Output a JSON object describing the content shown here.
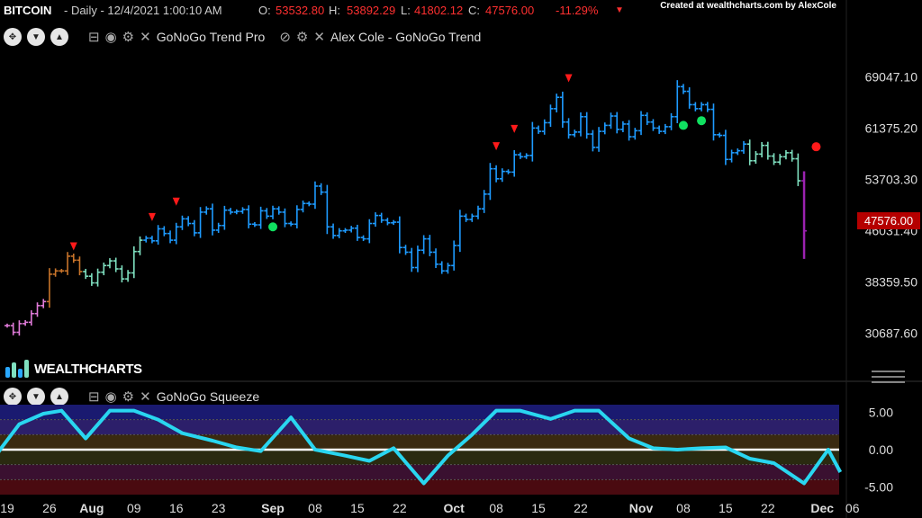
{
  "header": {
    "symbol": "BITCOIN",
    "info": "- Daily - 12/4/2021 1:00:10 AM",
    "o_label": "O:",
    "o_val": "53532.80",
    "h_label": "H:",
    "h_val": "53892.29",
    "l_label": "L:",
    "l_val": "41802.12",
    "c_label": "C:",
    "c_val": "47576.00",
    "change": "-11.29%",
    "dropdown": "▼"
  },
  "credit": "Created at wealthcharts.com by AlexCole",
  "indicators": {
    "main": [
      "GoNoGo Trend Pro",
      "Alex Cole - GoNoGo Trend"
    ],
    "lower": "GoNoGo Squeeze"
  },
  "logo_text": "WEALTHCHARTS",
  "price_badge": "47576.00",
  "colors": {
    "strong_go": "#1e9bff",
    "weak_go": "#7fe0c0",
    "weak_nogo": "#e07bd9",
    "strong_nogo": "#9b22b0",
    "amber": "#c8742a",
    "squeeze_line": "#29d6f0",
    "badge": "#b50000"
  },
  "chart_data": [
    {
      "type": "bar",
      "subtype": "ohlc",
      "y_ticks": [
        "69047.10",
        "61375.20",
        "53703.30",
        "46031.40",
        "38359.50",
        "30687.60"
      ],
      "ylim": [
        27500,
        72500
      ],
      "x_ticks": [
        "19",
        "26",
        "Aug",
        "09",
        "16",
        "23",
        "Sep",
        "08",
        "15",
        "22",
        "Oct",
        "08",
        "15",
        "22",
        "Nov",
        "08",
        "15",
        "22",
        "Dec",
        "06"
      ],
      "x_tick_dates": [
        "2021-07-19",
        "2021-07-26",
        "2021-08-02",
        "2021-08-09",
        "2021-08-16",
        "2021-08-23",
        "2021-09-01",
        "2021-09-08",
        "2021-09-15",
        "2021-09-22",
        "2021-10-01",
        "2021-10-08",
        "2021-10-15",
        "2021-10-22",
        "2021-11-01",
        "2021-11-08",
        "2021-11-15",
        "2021-11-22",
        "2021-12-01",
        "2021-12-06"
      ],
      "start_date": "2021-07-19",
      "closes": [
        31800,
        30800,
        32100,
        32300,
        33600,
        34800,
        35400,
        39500,
        40000,
        40000,
        42200,
        41600,
        39900,
        39200,
        38200,
        39800,
        40800,
        41500,
        40300,
        38800,
        39700,
        42900,
        44600,
        44900,
        44500,
        46300,
        45600,
        44600,
        46600,
        47800,
        47100,
        45700,
        48800,
        49300,
        46100,
        46800,
        49100,
        48800,
        48900,
        49200,
        47000,
        46900,
        49000,
        48200,
        49300,
        48800,
        47100,
        47000,
        49200,
        50100,
        50000,
        52700,
        51800,
        46600,
        45300,
        46000,
        46100,
        46400,
        45000,
        44800,
        47100,
        48300,
        47600,
        47200,
        47300,
        43500,
        42800,
        40500,
        43100,
        44800,
        42800,
        41000,
        40000,
        40800,
        43800,
        48200,
        47700,
        48200,
        49300,
        51500,
        55300,
        53800,
        54900,
        54800,
        57400,
        57100,
        57300,
        61400,
        60900,
        62200,
        64300,
        66000,
        62300,
        60400,
        60800,
        63100,
        60500,
        58500,
        60900,
        61800,
        63200,
        61200,
        62000,
        60100,
        61000,
        63300,
        62300,
        61400,
        60900,
        61600,
        63100,
        67600,
        66900,
        64900,
        64300,
        64900,
        64200,
        60400,
        60300,
        56700,
        57700,
        58000,
        59000,
        56500,
        57500,
        58800,
        57200,
        56300,
        57100,
        57700,
        56800,
        53500,
        46000
      ],
      "color_keys": "mmmmmmmaaaaaaggggggggggbbbbbbbbbbbbbbbbbbbbbbbbbbbbbbbbbbbbbbbbbbbbbbbbbbbbbbbbbbbbbbbbbbbbbbbbbbbbbbbbbbbbbbbbbbbbbbbbbbbbgggggggggggggggggggggggggmmmmmmmmmmmmmmmmmmmmmmmm",
      "go_markers": [
        {
          "date": "2021-09-01",
          "value": 46600
        },
        {
          "date": "2021-11-08",
          "value": 61800
        },
        {
          "date": "2021-11-11",
          "value": 62500
        }
      ],
      "nogo_markers": [
        {
          "date": "2021-11-30",
          "value": 58600
        }
      ],
      "sell_arrows": [
        {
          "date": "2021-07-30",
          "value": 43600
        },
        {
          "date": "2021-08-12",
          "value": 48000
        },
        {
          "date": "2021-08-16",
          "value": 50300
        },
        {
          "date": "2021-10-08",
          "value": 58600
        },
        {
          "date": "2021-10-11",
          "value": 61200
        },
        {
          "date": "2021-10-20",
          "value": 68800
        }
      ],
      "last_price": 47576.0
    },
    {
      "type": "line",
      "name": "GoNoGo Squeeze",
      "y_ticks": [
        "5.00",
        "0.00",
        "-5.00"
      ],
      "ylim": [
        -6,
        6
      ],
      "x": [
        "2021-07-14",
        "2021-07-18",
        "2021-07-21",
        "2021-07-25",
        "2021-07-28",
        "2021-08-01",
        "2021-08-05",
        "2021-08-09",
        "2021-08-13",
        "2021-08-17",
        "2021-08-22",
        "2021-08-26",
        "2021-08-30",
        "2021-09-04",
        "2021-09-08",
        "2021-09-13",
        "2021-09-17",
        "2021-09-21",
        "2021-09-26",
        "2021-09-30",
        "2021-10-04",
        "2021-10-08",
        "2021-10-12",
        "2021-10-17",
        "2021-10-21",
        "2021-10-25",
        "2021-10-30",
        "2021-11-03",
        "2021-11-07",
        "2021-11-11",
        "2021-11-15",
        "2021-11-19",
        "2021-11-23",
        "2021-11-28",
        "2021-12-02",
        "2021-12-04"
      ],
      "y": [
        -4.5,
        0.2,
        3.4,
        4.8,
        5.2,
        1.5,
        5.2,
        5.2,
        4.0,
        2.2,
        1.2,
        0.3,
        -0.2,
        4.3,
        0.0,
        -0.8,
        -1.5,
        0.2,
        -4.5,
        -0.8,
        2.0,
        5.2,
        5.2,
        4.1,
        5.2,
        5.2,
        1.5,
        0.2,
        0.0,
        0.2,
        0.3,
        -1.2,
        -1.8,
        -4.5,
        0.0,
        -3.0
      ]
    }
  ]
}
